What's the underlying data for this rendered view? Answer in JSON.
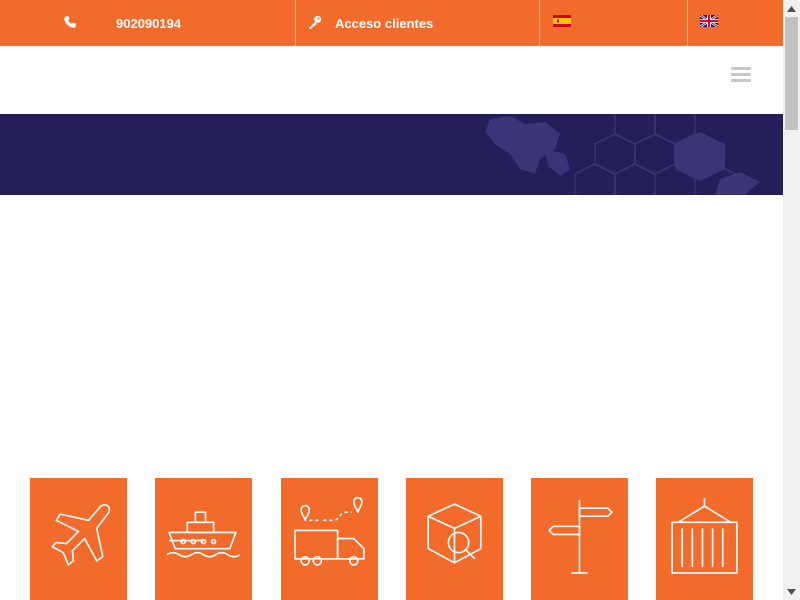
{
  "topbar": {
    "phone_icon": "phone-icon",
    "phone_number": "902090194",
    "client_icon": "key-icon",
    "client_access_label": "Acceso clientes",
    "languages": [
      {
        "code": "es",
        "icon": "spain-flag-icon"
      },
      {
        "code": "en",
        "icon": "uk-flag-icon"
      }
    ]
  },
  "header": {
    "menu_icon": "hamburger-menu-icon"
  },
  "services": [
    {
      "icon": "airplane-icon"
    },
    {
      "icon": "ship-icon"
    },
    {
      "icon": "delivery-truck-route-icon"
    },
    {
      "icon": "package-search-icon"
    },
    {
      "icon": "signpost-icon"
    },
    {
      "icon": "container-crane-icon"
    }
  ],
  "colors": {
    "brand_orange": "#f26b2a",
    "banner_navy": "#241e5b",
    "white": "#ffffff",
    "menu_grey": "#c8c8c8"
  }
}
